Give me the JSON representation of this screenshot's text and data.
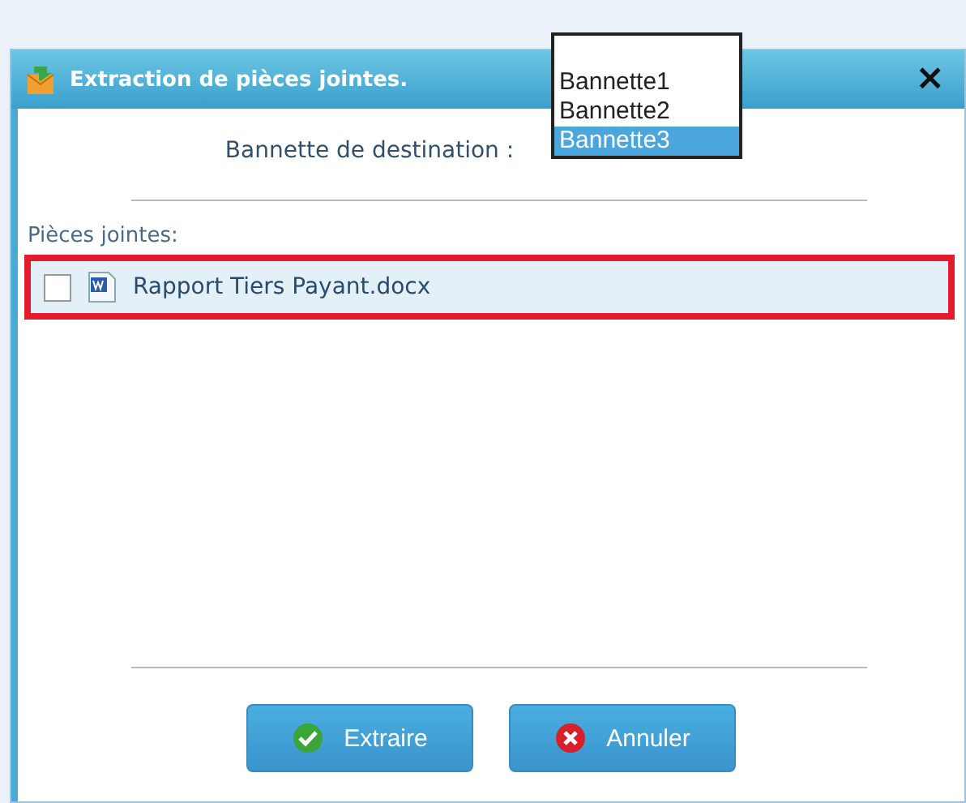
{
  "dialog": {
    "title": "Extraction de pièces jointes.",
    "close": "×"
  },
  "destination": {
    "label": "Bannette de destination :",
    "options": [
      {
        "label": "Bannette1",
        "selected": false
      },
      {
        "label": "Bannette2",
        "selected": false
      },
      {
        "label": "Bannette3",
        "selected": true
      }
    ]
  },
  "attachments": {
    "label": "Pièces jointes:",
    "items": [
      {
        "name": "Rapport Tiers Payant.docx",
        "checked": false,
        "highlighted": true
      }
    ]
  },
  "buttons": [
    {
      "label": "Extraire",
      "kind": "ok"
    },
    {
      "label": "Annuler",
      "kind": "cancel"
    }
  ]
}
